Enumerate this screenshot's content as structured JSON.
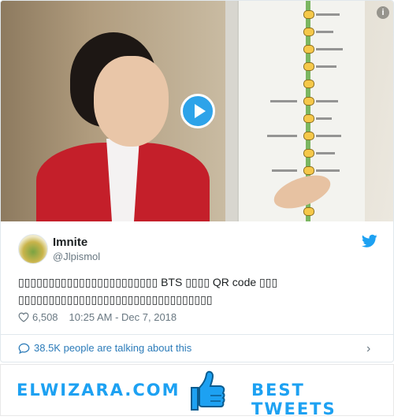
{
  "tweet": {
    "display_name": "Imnite",
    "handle": "@Jlpismol",
    "text": "▯▯▯▯▯▯▯▯▯▯▯▯▯▯▯▯▯▯▯▯▯▯▯ BTS ▯▯▯▯ QR code ▯▯▯ ▯▯▯▯▯▯▯▯▯▯▯▯▯▯▯▯▯▯▯▯▯▯▯▯▯▯▯▯▯▯▯▯",
    "likes": "6,508",
    "timestamp": "10:25 AM - Dec 7, 2018",
    "talking": "38.5K people are talking about this"
  },
  "media": {
    "info_label": "i"
  },
  "footer": {
    "brand_left": "ELWIZARA.COM",
    "brand_right": "BEST TWEETS"
  },
  "icons": {
    "play": "play-icon",
    "twitter": "twitter-bird-icon",
    "like": "heart-icon",
    "reply": "speech-bubble-icon",
    "more": "chevron-right-icon",
    "thumbs": "thumbs-up-icon"
  },
  "colors": {
    "accent": "#1da1f2",
    "link": "#2b7bb9",
    "muted": "#697882",
    "text": "#1c2022"
  }
}
